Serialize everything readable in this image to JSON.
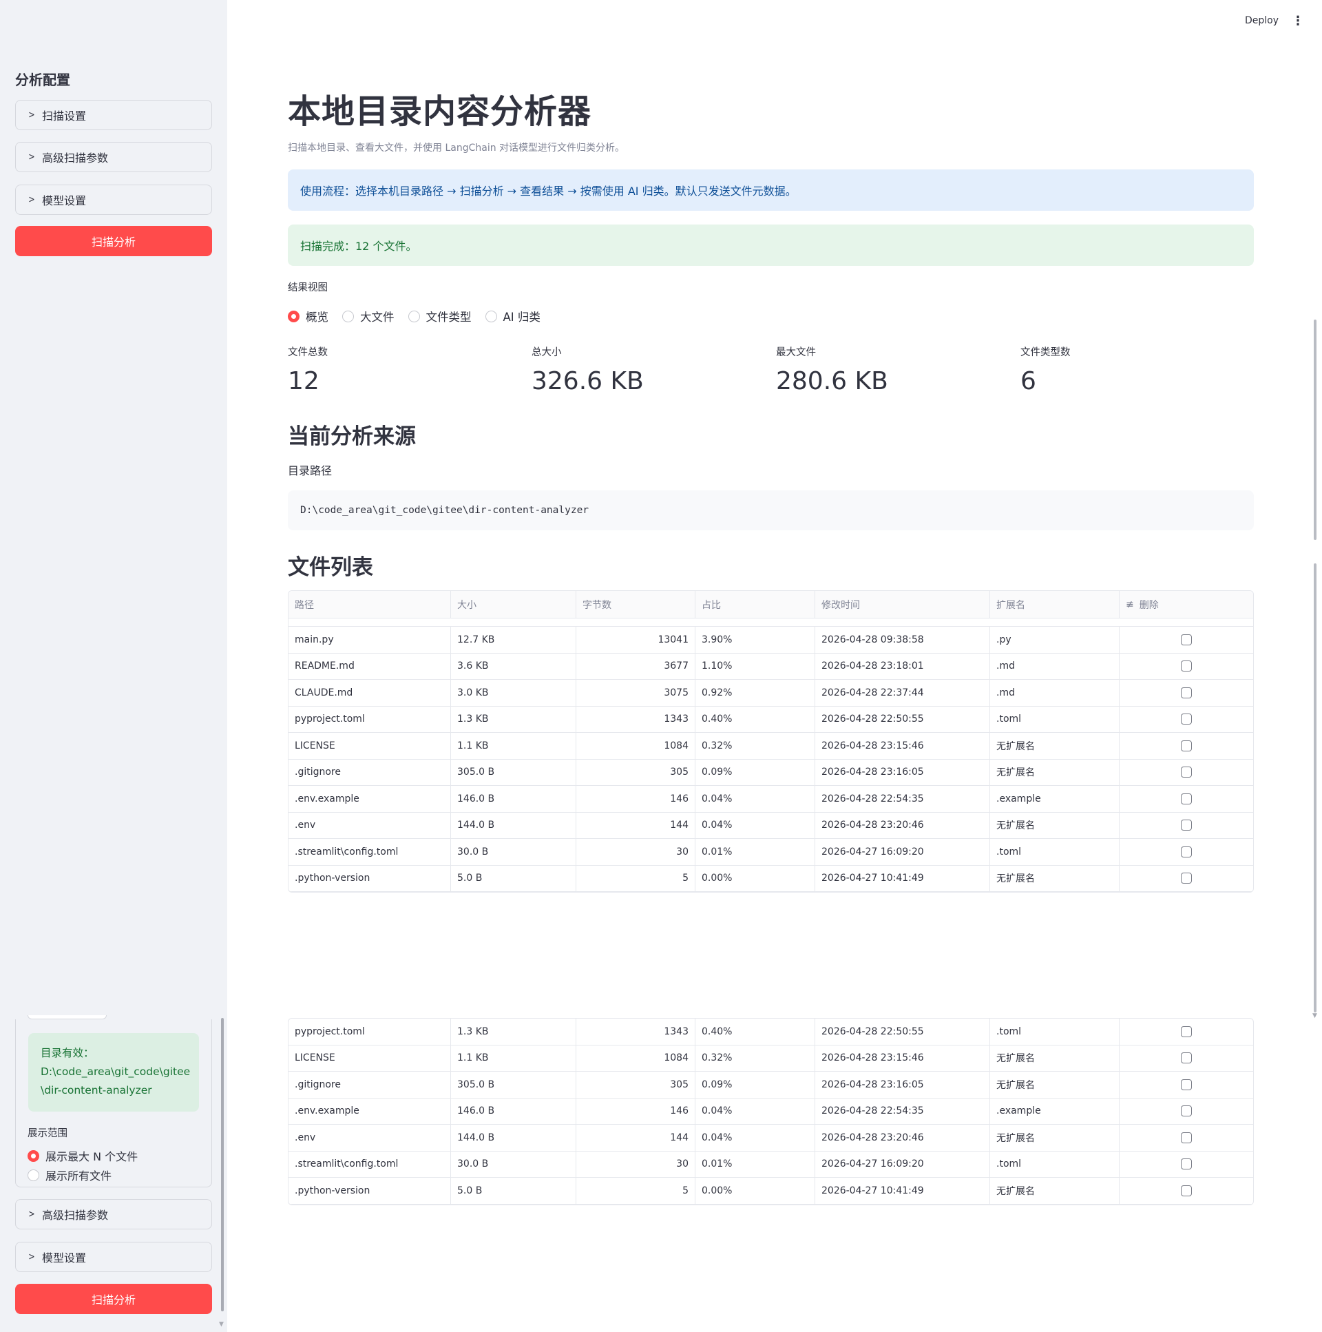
{
  "header": {
    "deploy_label": "Deploy",
    "menu_icon": "kebab-menu-icon"
  },
  "sidebar": {
    "title": "分析配置",
    "top_expanders": [
      "扫描设置",
      "高级扫描参数",
      "模型设置"
    ],
    "scan_button": "扫描分析",
    "dir_valid_line1": "目录有效：",
    "dir_valid_line2": "D:\\code_area\\git_code\\gitee",
    "dir_valid_line3": "\\dir-content-analyzer",
    "range_label": "展示范围",
    "range_options": [
      "展示最大 N 个文件",
      "展示所有文件"
    ],
    "range_selected": 0,
    "bottom_expanders": [
      "高级扫描参数",
      "模型设置"
    ],
    "scan_button_bottom": "扫描分析",
    "accent_color": "#ff4b4b"
  },
  "main": {
    "title": "本地目录内容分析器",
    "caption": "扫描本地目录、查看大文件，并使用 LangChain 对话模型进行文件归类分析。",
    "info_alert": "使用流程：选择本机目录路径 → 扫描分析 → 查看结果 → 按需使用 AI 归类。默认只发送文件元数据。",
    "success_alert": "扫描完成：12 个文件。",
    "view_label": "结果视图",
    "view_options": [
      "概览",
      "大文件",
      "文件类型",
      "AI 归类"
    ],
    "view_selected": 0,
    "metrics": [
      {
        "label": "文件总数",
        "value": "12"
      },
      {
        "label": "总大小",
        "value": "326.6 KB"
      },
      {
        "label": "最大文件",
        "value": "280.6 KB"
      },
      {
        "label": "文件类型数",
        "value": "6"
      }
    ],
    "source_heading": "当前分析来源",
    "path_label": "目录路径",
    "path_value": "D:\\code_area\\git_code\\gitee\\dir-content-analyzer",
    "files_heading": "文件列表"
  },
  "table": {
    "columns": [
      "路径",
      "大小",
      "字节数",
      "占比",
      "修改时间",
      "扩展名",
      "删除"
    ],
    "edit_icon": "edit-column-icon",
    "rows": [
      [
        "main.py",
        "12.7 KB",
        "13041",
        "3.90%",
        "2026-04-28 09:38:58",
        ".py"
      ],
      [
        "README.md",
        "3.6 KB",
        "3677",
        "1.10%",
        "2026-04-28 23:18:01",
        ".md"
      ],
      [
        "CLAUDE.md",
        "3.0 KB",
        "3075",
        "0.92%",
        "2026-04-28 22:37:44",
        ".md"
      ],
      [
        "pyproject.toml",
        "1.3 KB",
        "1343",
        "0.40%",
        "2026-04-28 22:50:55",
        ".toml"
      ],
      [
        "LICENSE",
        "1.1 KB",
        "1084",
        "0.32%",
        "2026-04-28 23:15:46",
        "无扩展名"
      ],
      [
        ".gitignore",
        "305.0 B",
        "305",
        "0.09%",
        "2026-04-28 23:16:05",
        "无扩展名"
      ],
      [
        ".env.example",
        "146.0 B",
        "146",
        "0.04%",
        "2026-04-28 22:54:35",
        ".example"
      ],
      [
        ".env",
        "144.0 B",
        "144",
        "0.04%",
        "2026-04-28 23:20:46",
        "无扩展名"
      ],
      [
        ".streamlit\\config.toml",
        "30.0 B",
        "30",
        "0.01%",
        "2026-04-27 16:09:20",
        ".toml"
      ],
      [
        ".python-version",
        "5.0 B",
        "5",
        "0.00%",
        "2026-04-27 10:41:49",
        "无扩展名"
      ]
    ],
    "rows_second": [
      [
        "pyproject.toml",
        "1.3 KB",
        "1343",
        "0.40%",
        "2026-04-28 22:50:55",
        ".toml"
      ],
      [
        "LICENSE",
        "1.1 KB",
        "1084",
        "0.32%",
        "2026-04-28 23:15:46",
        "无扩展名"
      ],
      [
        ".gitignore",
        "305.0 B",
        "305",
        "0.09%",
        "2026-04-28 23:16:05",
        "无扩展名"
      ],
      [
        ".env.example",
        "146.0 B",
        "146",
        "0.04%",
        "2026-04-28 22:54:35",
        ".example"
      ],
      [
        ".env",
        "144.0 B",
        "144",
        "0.04%",
        "2026-04-28 23:20:46",
        "无扩展名"
      ],
      [
        ".streamlit\\config.toml",
        "30.0 B",
        "30",
        "0.01%",
        "2026-04-27 16:09:20",
        ".toml"
      ],
      [
        ".python-version",
        "5.0 B",
        "5",
        "0.00%",
        "2026-04-27 10:41:49",
        "无扩展名"
      ]
    ]
  }
}
